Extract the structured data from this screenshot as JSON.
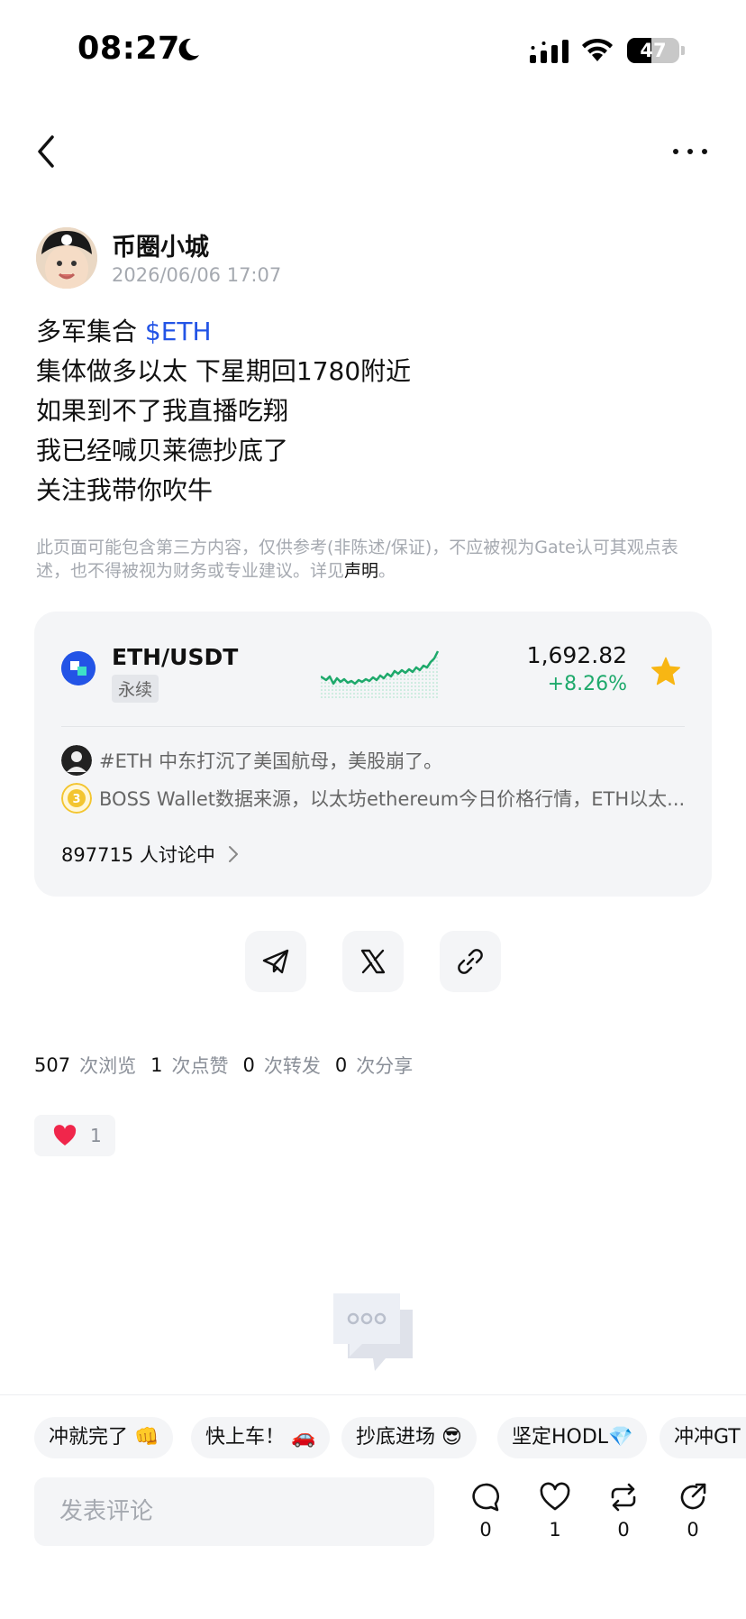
{
  "status_bar": {
    "time": "08:27",
    "battery": "47",
    "battery_level": 0.47
  },
  "post": {
    "author": "币圈小城",
    "timestamp": "2026/06/06 17:07",
    "lines": [
      {
        "text": "多军集合 ",
        "tag": "$ETH"
      },
      {
        "text": "集体做多以太 下星期回1780附近"
      },
      {
        "text": "如果到不了我直播吃翔"
      },
      {
        "text": "我已经喊贝莱德抄底了"
      },
      {
        "text": "关注我带你吹牛"
      }
    ]
  },
  "disclaimer": {
    "text": "此页面可能包含第三方内容，仅供参考(非陈述/保证)，不应被视为Gate认可其观点表述，也不得被视为财务或专业建议。详见",
    "link": "声明",
    "end": "。"
  },
  "market_card": {
    "pair": "ETH/USDT",
    "type": "永续",
    "price": "1,692.82",
    "change": "+8.26%",
    "news": [
      {
        "icon": "user-avatar-icon",
        "text": "#ETH 中东打沉了美国航母，美股崩了。"
      },
      {
        "icon": "boss-wallet-icon",
        "text": "BOSS Wallet数据来源，以太坊ethereum今日价格行情，ETH以太..."
      }
    ],
    "discussion": "897715 人讨论中"
  },
  "stats": [
    {
      "count": "507",
      "label": "次浏览"
    },
    {
      "count": "1",
      "label": "次点赞"
    },
    {
      "count": "0",
      "label": "次转发"
    },
    {
      "count": "0",
      "label": "次分享"
    }
  ],
  "reaction": {
    "emoji": "heart-icon",
    "count": "1"
  },
  "quick_replies": [
    "冲就完了 👊",
    "快上车！ 🚗",
    "抄底进场 😎",
    "坚定HODL💎",
    "冲冲GT"
  ],
  "comment_placeholder": "发表评论",
  "actions": [
    {
      "icon": "comment-icon",
      "count": "0"
    },
    {
      "icon": "like-icon",
      "count": "1"
    },
    {
      "icon": "repost-icon",
      "count": "0"
    },
    {
      "icon": "share-icon",
      "count": "0"
    }
  ],
  "colors": {
    "accent": "#2354e6",
    "positive": "#1ea96b",
    "star": "#f8b613",
    "like": "#f0264b"
  }
}
